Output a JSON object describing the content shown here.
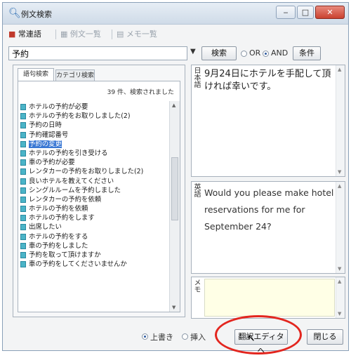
{
  "window": {
    "title": "例文検索",
    "title_icon": "search-magnifier-icon",
    "controls": {
      "minimize": "‒",
      "maximize": "□",
      "close": "✕"
    }
  },
  "toolbar": {
    "favorites": "常連語",
    "example_list": "例文一覧",
    "memo_list": "メモ一覧"
  },
  "search": {
    "query": "予約",
    "search_button": "検索",
    "or_label": "OR",
    "and_label": "AND",
    "selected_mode": "AND",
    "conditions_button": "条件"
  },
  "tabs": [
    "語句検索",
    "カテゴリ検索"
  ],
  "results": {
    "count_text": "39 件、検索されました",
    "items": [
      "ホテルの予約が必要",
      "ホテルの予約をお取りしました(2)",
      "予約の日時",
      "予約確認番号",
      "予約の変更",
      "ホテルの予約を引き受ける",
      "車の予約が必要",
      "レンタカーの予約をお取りしました(2)",
      "良いホテルを教えてください",
      "シングルルームを予約しました",
      "レンタカーの予約を依頼",
      "ホテルの予約を依頼",
      "ホテルの予約をします",
      "出席したい",
      "ホテルの予約をする",
      "車の予約をしました",
      "予約を取って頂けますか",
      "車の予約をしてくださいませんか"
    ],
    "selected_index": 4
  },
  "japanese_pane": {
    "label": "日本語",
    "text": "9月24日にホテルを手配して頂ければ幸いです。"
  },
  "english_pane": {
    "label": "英語",
    "text": "Would you please make hotel reservations for me for September 24?"
  },
  "memo_pane": {
    "label": "メモ"
  },
  "bottom": {
    "overwrite_label": "上書き",
    "insert_label": "挿入",
    "translate_editor_button": "翻訳エディタへ",
    "close_button": "閉じる"
  }
}
